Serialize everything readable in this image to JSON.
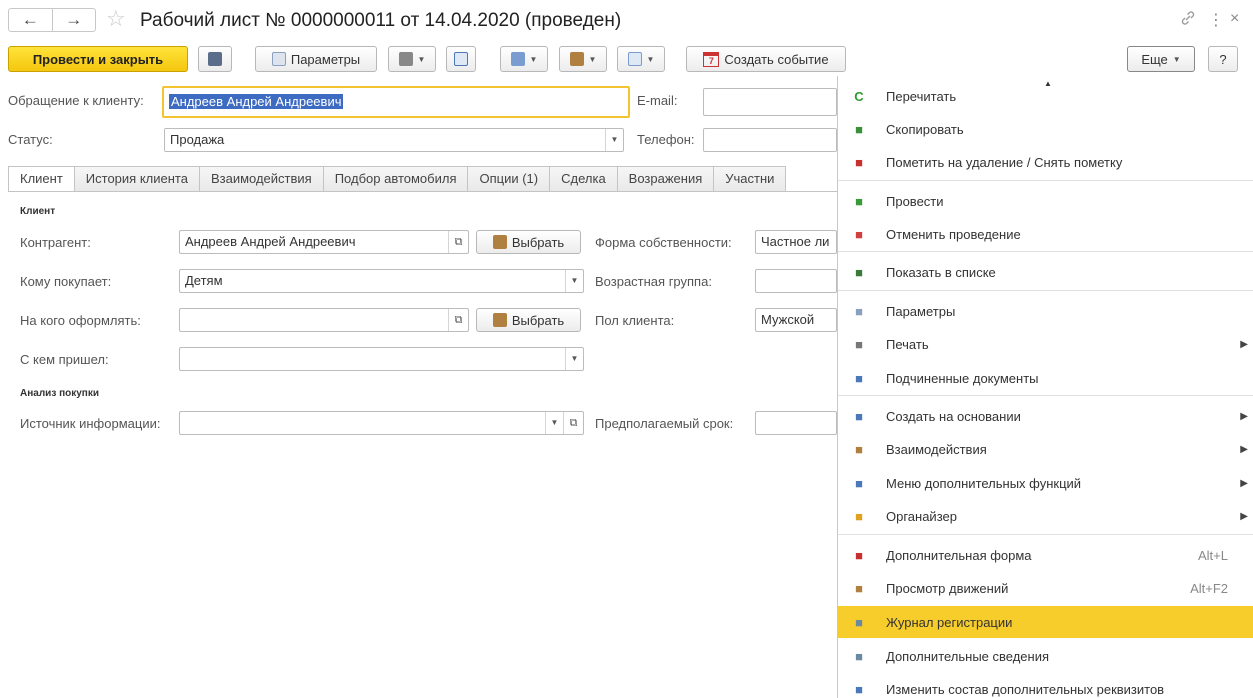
{
  "window": {
    "title": "Рабочий лист № 0000000011  от 14.04.2020 (проведен)",
    "back": "←",
    "forward": "→",
    "star": "☆",
    "link_icon": "🔗",
    "more": "⋮",
    "close": "×"
  },
  "toolbar": {
    "post_close": "Провести и закрыть",
    "params": "Параметры",
    "create_event": "Создать событие",
    "calendar_num": "7",
    "more": "Еще",
    "help": "?"
  },
  "header": {
    "client_label": "Обращение к клиенту:",
    "client_value": "Андреев Андрей Андреевич",
    "status_label": "Статус:",
    "status_value": "Продажа",
    "email_label": "E-mail:",
    "email_value": "",
    "phone_label": "Телефон:",
    "phone_value": ""
  },
  "tabs": [
    "Клиент",
    "История клиента",
    "Взаимодействия",
    "Подбор автомобиля",
    "Опции (1)",
    "Сделка",
    "Возражения",
    "Участни"
  ],
  "client_tab": {
    "section_client": "Клиент",
    "contractor_label": "Контрагент:",
    "contractor_value": "Андреев Андрей Андреевич",
    "choose_label": "Выбрать",
    "buyer_for_label": "Кому покупает:",
    "buyer_for_value": "Детям",
    "register_to_label": "На кого оформлять:",
    "register_to_value": "",
    "came_with_label": "С кем пришел:",
    "came_with_value": "",
    "section_analysis": "Анализ покупки",
    "source_label": "Источник информации:",
    "source_value": "",
    "ownership_label": "Форма собственности:",
    "ownership_value": "Частное ли",
    "age_group_label": "Возрастная группа:",
    "age_group_value": "",
    "gender_label": "Пол клиента:",
    "gender_value": "Мужской",
    "term_label": "Предполагаемый срок:",
    "term_value": ""
  },
  "menu": {
    "items": [
      {
        "label": "Перечитать",
        "icon": "refresh-icon",
        "glyph": "C",
        "color": "#2e9a2e"
      },
      {
        "label": "Скопировать",
        "icon": "copy-icon",
        "glyph": "■",
        "color": "#3a8f3a"
      },
      {
        "label": "Пометить на удаление / Снять пометку",
        "icon": "delete-mark-icon",
        "glyph": "■",
        "color": "#c83030"
      },
      {
        "label": "Провести",
        "icon": "post-icon",
        "glyph": "■",
        "color": "#3a9a3a"
      },
      {
        "label": "Отменить проведение",
        "icon": "unpost-icon",
        "glyph": "■",
        "color": "#d04040"
      },
      {
        "label": "Показать в списке",
        "icon": "show-list-icon",
        "glyph": "■",
        "color": "#3a7a3a"
      },
      {
        "label": "Параметры",
        "icon": "params-icon",
        "glyph": "■",
        "color": "#8aa0c0"
      },
      {
        "label": "Печать",
        "icon": "print-icon",
        "glyph": "■",
        "color": "#777777",
        "submenu": true
      },
      {
        "label": "Подчиненные документы",
        "icon": "subordinate-docs-icon",
        "glyph": "■",
        "color": "#4a78b8"
      },
      {
        "label": "Создать на основании",
        "icon": "create-based-icon",
        "glyph": "■",
        "color": "#4a78b8",
        "submenu": true
      },
      {
        "label": "Взаимодействия",
        "icon": "interactions-icon",
        "glyph": "■",
        "color": "#b08040",
        "submenu": true
      },
      {
        "label": "Меню дополнительных функций",
        "icon": "extra-functions-icon",
        "glyph": "■",
        "color": "#4a78b8",
        "submenu": true
      },
      {
        "label": "Органайзер",
        "icon": "organizer-icon",
        "glyph": "■",
        "color": "#e0a020",
        "submenu": true
      },
      {
        "label": "Дополнительная форма",
        "icon": "extra-form-icon",
        "glyph": "■",
        "color": "#c83030",
        "shortcut": "Alt+L"
      },
      {
        "label": "Просмотр движений",
        "icon": "view-movements-icon",
        "glyph": "■",
        "color": "#b08040",
        "shortcut": "Alt+F2"
      },
      {
        "label": "Журнал регистрации",
        "icon": "event-log-icon",
        "glyph": "■",
        "color": "#6a8aa0",
        "highlight": true
      },
      {
        "label": "Дополнительные сведения",
        "icon": "extra-info-icon",
        "glyph": "■",
        "color": "#6a8aa0"
      },
      {
        "label": "Изменить состав дополнительных реквизитов",
        "icon": "edit-attributes-icon",
        "glyph": "■",
        "color": "#4a78b8"
      }
    ],
    "arrow": "▶"
  }
}
